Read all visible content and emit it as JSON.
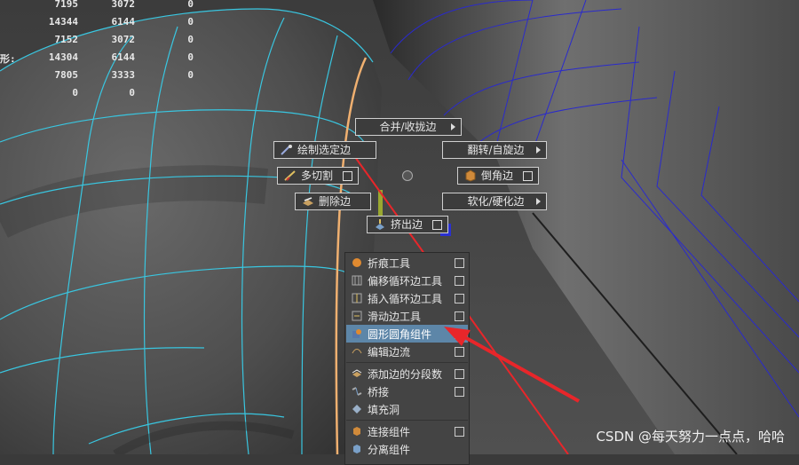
{
  "hud": {
    "rows": [
      {
        "label": "",
        "a": "7195",
        "b": "3072",
        "c": "0"
      },
      {
        "label": "",
        "a": "14344",
        "b": "6144",
        "c": "0"
      },
      {
        "label": "",
        "a": "7152",
        "b": "3072",
        "c": "0"
      },
      {
        "label": "形:",
        "a": "14304",
        "b": "6144",
        "c": "0"
      },
      {
        "label": "",
        "a": "7805",
        "b": "3333",
        "c": "0"
      },
      {
        "label": "",
        "a": "0",
        "b": "0",
        "c": ""
      }
    ]
  },
  "marking_menu": {
    "north": "合并/收拢边",
    "northwest": "绘制选定边",
    "northeast": "翻转/自旋边",
    "west": "多切割",
    "east": "倒角边",
    "southwest": "删除边",
    "southeast": "软化/硬化边",
    "south": "挤出边"
  },
  "context_menu": {
    "items": [
      {
        "label": "折痕工具",
        "icon": "crease-icon",
        "option_box": true
      },
      {
        "label": "偏移循环边工具",
        "icon": "offset-loop-icon",
        "option_box": true
      },
      {
        "label": "插入循环边工具",
        "icon": "insert-loop-icon",
        "option_box": true
      },
      {
        "label": "滑动边工具",
        "icon": "slide-edge-icon",
        "option_box": true
      },
      {
        "label": "圆形圆角组件",
        "icon": "circularize-icon",
        "option_box": true,
        "highlighted": true
      },
      {
        "label": "编辑边流",
        "icon": "edge-flow-icon",
        "option_box": true
      },
      {
        "label": "添加边的分段数",
        "icon": "add-divisions-icon",
        "option_box": true
      },
      {
        "label": "桥接",
        "icon": "bridge-icon",
        "option_box": true
      },
      {
        "label": "填充洞",
        "icon": "fill-hole-icon",
        "option_box": false
      },
      {
        "label": "连接组件",
        "icon": "connect-icon",
        "option_box": true
      },
      {
        "label": "分离组件",
        "icon": "detach-icon",
        "option_box": false
      }
    ]
  },
  "watermark": "CSDN @每天努力一点点，哈哈",
  "colors": {
    "wire": "#39c6e0",
    "wire_dark": "#2a2acc",
    "selected_edge": "#f0b070",
    "arrow": "#e8262a",
    "highlight": "#5d86a8"
  }
}
